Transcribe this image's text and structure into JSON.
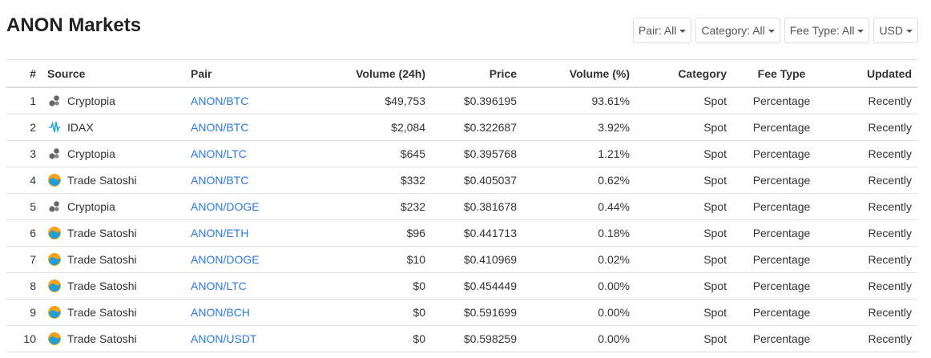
{
  "page": {
    "title": "ANON Markets"
  },
  "filters": [
    {
      "label": "Pair: All"
    },
    {
      "label": "Category: All"
    },
    {
      "label": "Fee Type: All"
    },
    {
      "label": "USD"
    }
  ],
  "table": {
    "headers": [
      "#",
      "Source",
      "Pair",
      "Volume (24h)",
      "Price",
      "Volume (%)",
      "Category",
      "Fee Type",
      "Updated"
    ],
    "rows": [
      {
        "rank": "1",
        "source": "Cryptopia",
        "icon": "cryptopia-icon",
        "pair": "ANON/BTC",
        "volume": "$49,753",
        "price": "$0.396195",
        "volume_pct": "93.61%",
        "category": "Spot",
        "fee_type": "Percentage",
        "updated": "Recently"
      },
      {
        "rank": "2",
        "source": "IDAX",
        "icon": "idax-icon",
        "pair": "ANON/BTC",
        "volume": "$2,084",
        "price": "$0.322687",
        "volume_pct": "3.92%",
        "category": "Spot",
        "fee_type": "Percentage",
        "updated": "Recently"
      },
      {
        "rank": "3",
        "source": "Cryptopia",
        "icon": "cryptopia-icon",
        "pair": "ANON/LTC",
        "volume": "$645",
        "price": "$0.395768",
        "volume_pct": "1.21%",
        "category": "Spot",
        "fee_type": "Percentage",
        "updated": "Recently"
      },
      {
        "rank": "4",
        "source": "Trade Satoshi",
        "icon": "tradesatoshi-icon",
        "pair": "ANON/BTC",
        "volume": "$332",
        "price": "$0.405037",
        "volume_pct": "0.62%",
        "category": "Spot",
        "fee_type": "Percentage",
        "updated": "Recently"
      },
      {
        "rank": "5",
        "source": "Cryptopia",
        "icon": "cryptopia-icon",
        "pair": "ANON/DOGE",
        "volume": "$232",
        "price": "$0.381678",
        "volume_pct": "0.44%",
        "category": "Spot",
        "fee_type": "Percentage",
        "updated": "Recently"
      },
      {
        "rank": "6",
        "source": "Trade Satoshi",
        "icon": "tradesatoshi-icon",
        "pair": "ANON/ETH",
        "volume": "$96",
        "price": "$0.441713",
        "volume_pct": "0.18%",
        "category": "Spot",
        "fee_type": "Percentage",
        "updated": "Recently"
      },
      {
        "rank": "7",
        "source": "Trade Satoshi",
        "icon": "tradesatoshi-icon",
        "pair": "ANON/DOGE",
        "volume": "$10",
        "price": "$0.410969",
        "volume_pct": "0.02%",
        "category": "Spot",
        "fee_type": "Percentage",
        "updated": "Recently"
      },
      {
        "rank": "8",
        "source": "Trade Satoshi",
        "icon": "tradesatoshi-icon",
        "pair": "ANON/LTC",
        "volume": "$0",
        "price": "$0.454449",
        "volume_pct": "0.00%",
        "category": "Spot",
        "fee_type": "Percentage",
        "updated": "Recently"
      },
      {
        "rank": "9",
        "source": "Trade Satoshi",
        "icon": "tradesatoshi-icon",
        "pair": "ANON/BCH",
        "volume": "$0",
        "price": "$0.591699",
        "volume_pct": "0.00%",
        "category": "Spot",
        "fee_type": "Percentage",
        "updated": "Recently"
      },
      {
        "rank": "10",
        "source": "Trade Satoshi",
        "icon": "tradesatoshi-icon",
        "pair": "ANON/USDT",
        "volume": "$0",
        "price": "$0.598259",
        "volume_pct": "0.00%",
        "category": "Spot",
        "fee_type": "Percentage",
        "updated": "Recently"
      }
    ]
  },
  "colors": {
    "link": "#2a7ae2",
    "border": "#dddddd",
    "text": "#333333",
    "idax": "#29a8e0",
    "tradesatoshi_orange": "#f7a21b",
    "tradesatoshi_blue": "#1e9fd8",
    "cryptopia": "#666666"
  }
}
